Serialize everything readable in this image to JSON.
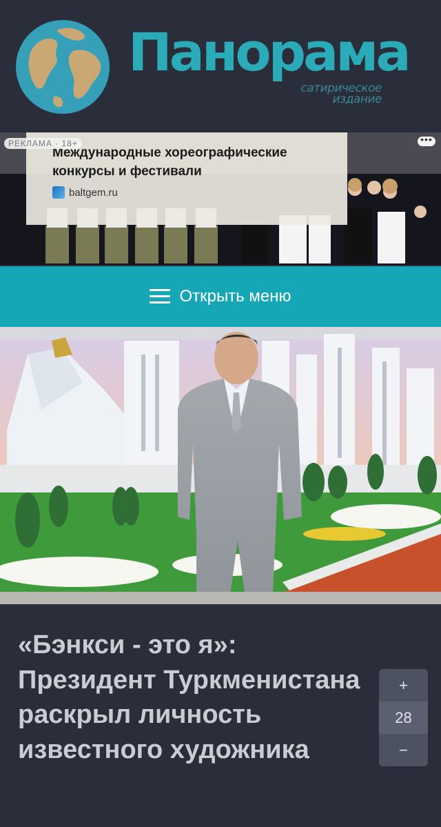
{
  "header": {
    "logo_title": "Панорама",
    "logo_subtitle_line1": "сатирическое",
    "logo_subtitle_line2": "издание",
    "brand_color": "#2baab8"
  },
  "ad": {
    "label": "РЕКЛАМА · 18+",
    "headline": "Международные хореографические конкурсы и фестивали",
    "domain": "baltgem.ru",
    "menu_dots": "•••"
  },
  "menu": {
    "label": "Открыть меню",
    "icon": "hamburger-icon",
    "bar_color": "#16a7b7"
  },
  "hero": {
    "image": "photo-president-in-grey-suit-with-monument-and-flowerbed"
  },
  "article": {
    "title": "«Бэнкси - это я»: Президент Туркменистана раскрыл личность известного художника"
  },
  "vote": {
    "plus": "+",
    "count": "28",
    "minus": "−"
  }
}
